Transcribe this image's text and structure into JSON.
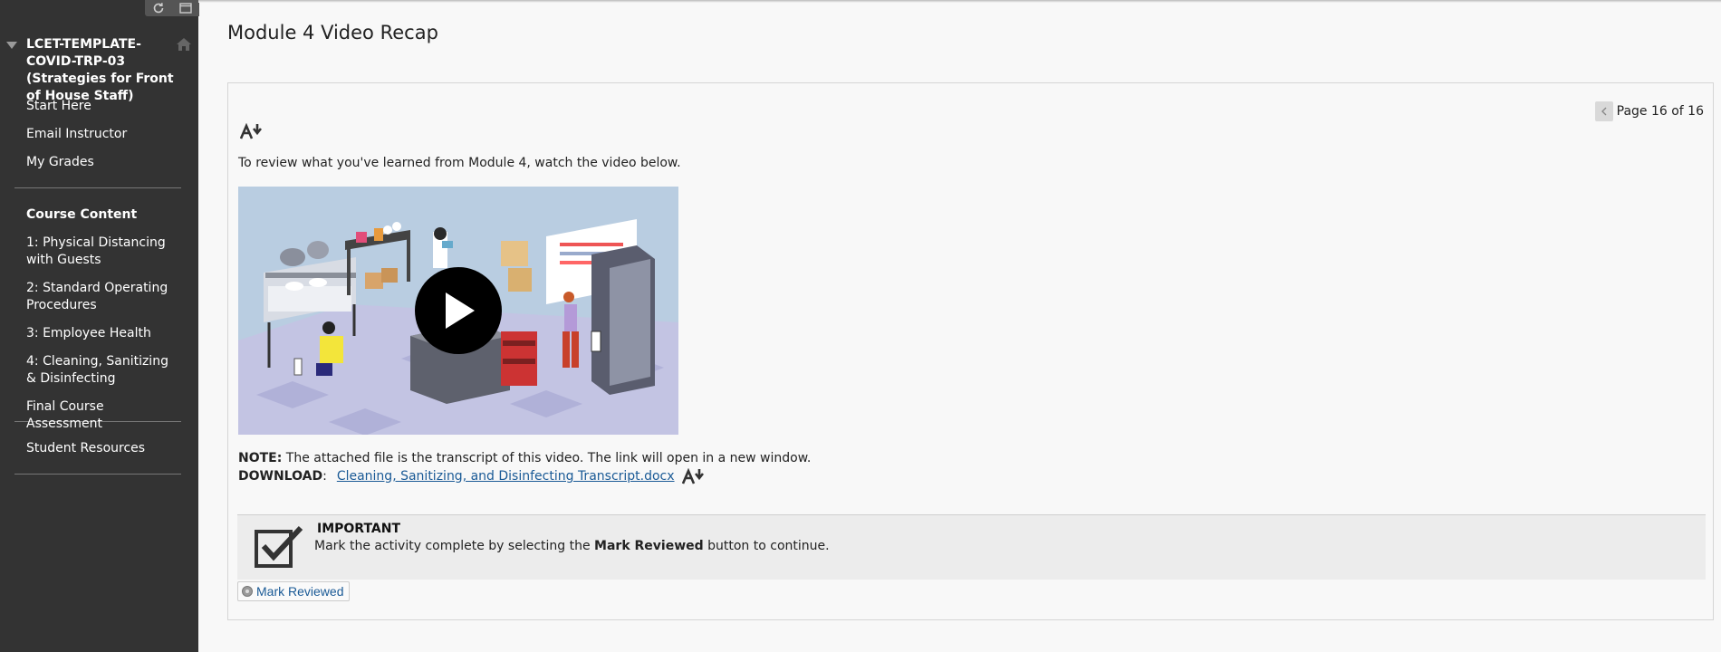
{
  "sidebar": {
    "course_title": "LCET-TEMPLATE-COVID-TRP-03 (Strategies for Front of House Staff)",
    "top_tools": [
      "refresh-icon",
      "window-icon"
    ],
    "home_icon": "home-icon",
    "links": [
      "Start Here",
      "Email Instructor",
      "My Grades"
    ],
    "course_content_heading": "Course Content",
    "modules": [
      "1: Physical Distancing with Guests",
      "2: Standard Operating Procedures",
      "3: Employee Health",
      "4: Cleaning, Sanitizing & Disinfecting",
      "Final Course Assessment"
    ],
    "student_resources": "Student Resources"
  },
  "main": {
    "page_title": "Module 4 Video Recap",
    "pager": {
      "text": "Page 16 of 16"
    },
    "intro_text": "To review what you've learned from Module 4, watch the video below.",
    "note_label": "NOTE:",
    "note_text": " The attached file is the transcript of this video. The link will open in a new window.",
    "download_label": "DOWNLOAD",
    "download_colon": ":",
    "download_link": "Cleaning, Sanitizing, and Disinfecting Transcript.docx",
    "important": {
      "title": "IMPORTANT",
      "text_before": "Mark the activity complete by selecting the ",
      "text_bold": "Mark Reviewed",
      "text_after": " button to continue."
    },
    "mark_reviewed_label": "Mark Reviewed"
  },
  "colors": {
    "sidebar_bg": "#333333",
    "link": "#1a5a96",
    "video_bg": "#b7cce0"
  }
}
